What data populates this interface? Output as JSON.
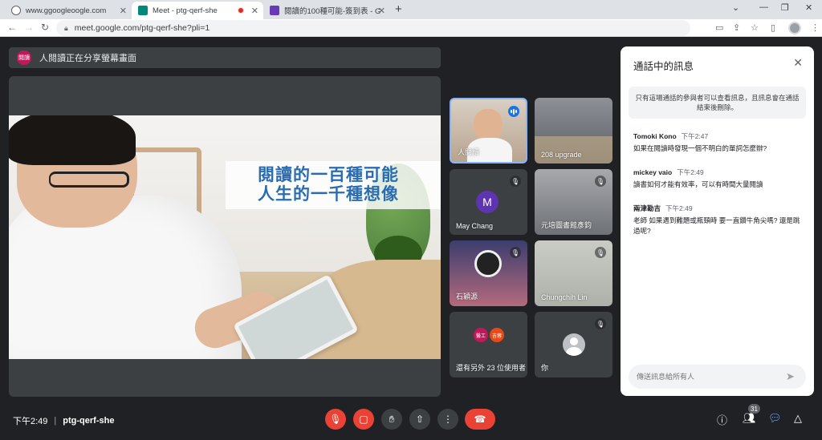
{
  "browser": {
    "tabs": [
      {
        "title": "www.ggoogleoogle.com",
        "favicon_color": "#5f6368"
      },
      {
        "title": "Meet - ptg-qerf-she",
        "favicon_color": "#00897b"
      },
      {
        "title": "閱讀的100種可能-簽到表 - Goog",
        "favicon_color": "#673ab7"
      }
    ],
    "close_glyph": "✕",
    "new_tab_glyph": "+",
    "url": "meet.google.com/ptg-qerf-she?pli=1"
  },
  "meet": {
    "presenting_avatar": "閱讀",
    "presenting_text": "人閱讀正在分享螢幕畫面",
    "slide": {
      "line1": "閱讀的一百種可能",
      "line2": "人生的一千種想像"
    },
    "tiles": [
      {
        "name": "人閱讀"
      },
      {
        "name": "208 upgrade"
      },
      {
        "name": "May Chang",
        "initial": "M"
      },
      {
        "name": "元培圖書館彥鈞"
      },
      {
        "name": "石穎源"
      },
      {
        "name": "Chungchih Lin"
      },
      {
        "name": "還有另外 23 位使用者",
        "mini1": "醫工",
        "mini2": "吉蓉"
      },
      {
        "name": "你"
      }
    ],
    "time": "下午2:49",
    "meeting_code": "ptg-qerf-she",
    "participant_count": "31"
  },
  "chat": {
    "title": "通話中的訊息",
    "notice": "只有這場通話的參與者可以查看訊息，且訊息會在通話結束後刪除。",
    "messages": [
      {
        "sender": "Tomoki Kono",
        "time": "下午2:47",
        "text": "如果在閱讀時發現一個不明白的單詞怎麼辦?"
      },
      {
        "sender": "mickey vaio",
        "time": "下午2:49",
        "text": "讀書如何才能有效率，可以有時間大量閱讀"
      },
      {
        "sender": "兩津勘吉",
        "time": "下午2:49",
        "text": "老師 如果遇到難題或瓶頸時 要一直鑽牛角尖嗎? 還是跳過呢?"
      }
    ],
    "input_placeholder": "傳送訊息給所有人"
  },
  "colors": {
    "accent": "#1a73e8",
    "danger": "#ea4335",
    "background": "#202124"
  }
}
